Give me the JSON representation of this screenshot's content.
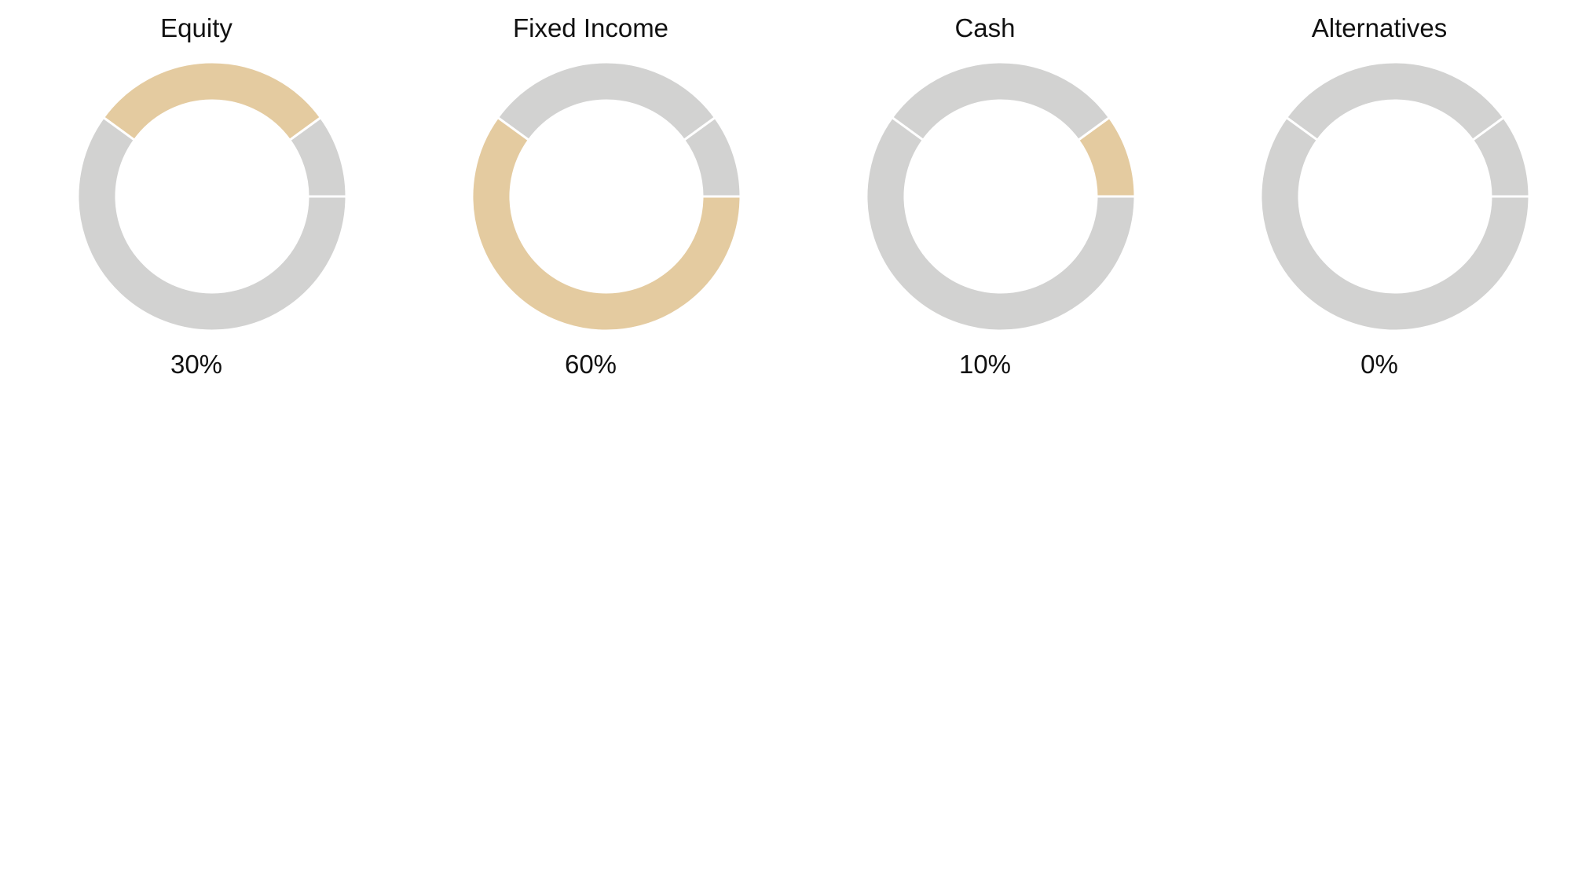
{
  "colors": {
    "highlight": "#e4cba0",
    "base": "#d2d2d1",
    "separator": "#ffffff"
  },
  "chart_data": [
    {
      "type": "pie",
      "variant": "donut",
      "title": "Equity",
      "value_label": "30%",
      "highlighted_segment": 1,
      "segments": [
        10,
        30,
        60
      ]
    },
    {
      "type": "pie",
      "variant": "donut",
      "title": "Fixed Income",
      "value_label": "60%",
      "highlighted_segment": 2,
      "segments": [
        10,
        30,
        60
      ]
    },
    {
      "type": "pie",
      "variant": "donut",
      "title": "Cash",
      "value_label": "10%",
      "highlighted_segment": 0,
      "segments": [
        10,
        30,
        60
      ]
    },
    {
      "type": "pie",
      "variant": "donut",
      "title": "Alternatives",
      "value_label": "0%",
      "highlighted_segment": null,
      "segments": [
        10,
        30,
        60
      ]
    }
  ]
}
